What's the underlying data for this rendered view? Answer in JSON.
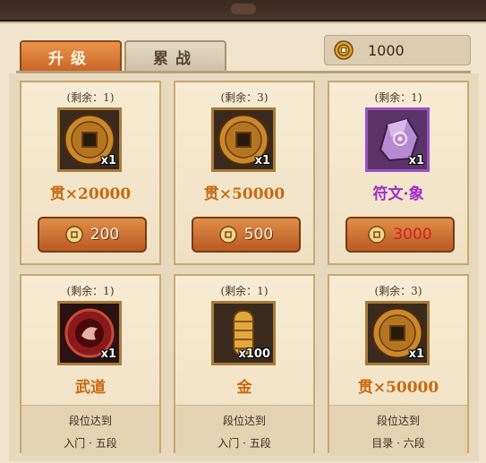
{
  "tabs": [
    {
      "label": "升级",
      "active": true
    },
    {
      "label": "累战",
      "active": false
    }
  ],
  "currency": {
    "icon": "coin-icon",
    "amount": "1000"
  },
  "items": [
    {
      "remaining": "(剩余：1)",
      "qty": "x1",
      "name": "贯×20000",
      "icon": "copper-coin-icon",
      "price": "200"
    },
    {
      "remaining": "(剩余：3)",
      "qty": "x1",
      "name": "贯×50000",
      "icon": "copper-coin-icon",
      "price": "500"
    },
    {
      "remaining": "(剩余：1)",
      "qty": "x1",
      "name": "符文·象",
      "icon": "purple-rune-stone-icon",
      "price": "3000",
      "price_insufficient": true
    },
    {
      "remaining": "(剩余：1)",
      "qty": "x1",
      "name": "武道",
      "icon": "martial-emblem-icon",
      "condition_line1": "段位达到",
      "condition_line2": "入门 · 五段"
    },
    {
      "remaining": "(剩余：1)",
      "qty": "x100",
      "name": "金",
      "icon": "gold-bar-icon",
      "condition_line1": "段位达到",
      "condition_line2": "入门 · 五段"
    },
    {
      "remaining": "(剩余：3)",
      "qty": "x1",
      "name": "贯×50000",
      "icon": "copper-coin-icon",
      "condition_line1": "段位达到",
      "condition_line2": "目录 · 六段"
    }
  ],
  "colors": {
    "accent": "#c86a10",
    "purple_name": "#a02cc8",
    "insufficient_price": "#d82020"
  }
}
